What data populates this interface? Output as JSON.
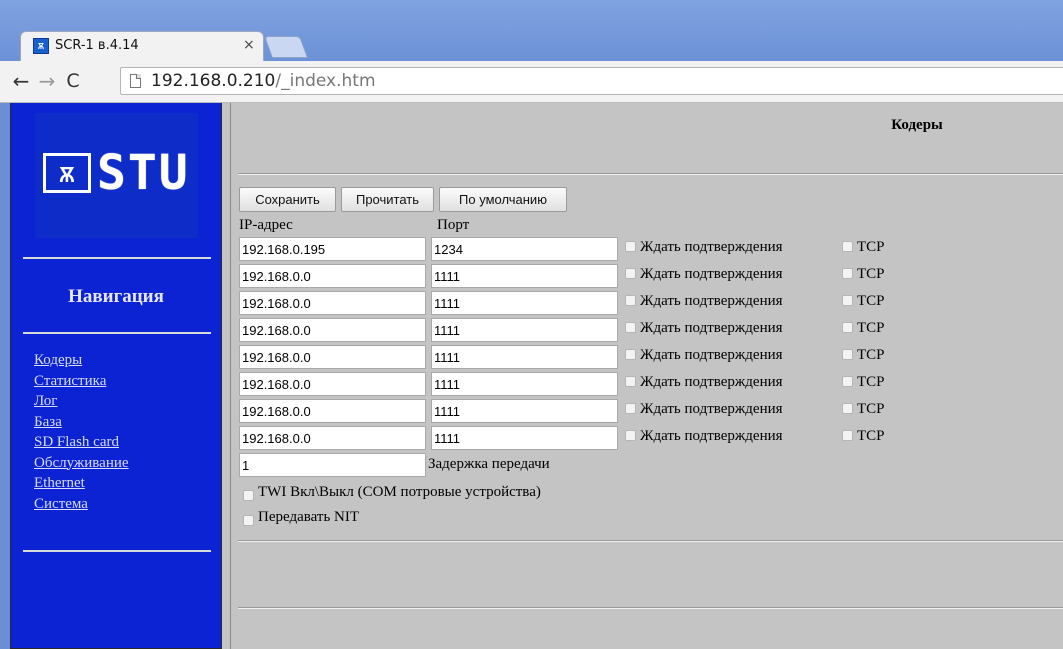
{
  "browser": {
    "tab_title": "SCR-1 в.4.14",
    "tab_close": "×",
    "favicon_glyph": "ѫ",
    "url_host": "192.168.0.210",
    "url_path": "/_index.htm",
    "back": "←",
    "forward": "→",
    "reload": "C"
  },
  "sidebar": {
    "logo_text": "STU",
    "logo_mark": "ѫ",
    "nav_title": "Навигация",
    "links": [
      "Кодеры",
      "Статистика",
      "Лог",
      "База",
      "SD Flash card",
      "Обслуживание",
      "Ethernet",
      "Система"
    ]
  },
  "content": {
    "title": "Кодеры",
    "buttons": {
      "save": "Сохранить",
      "read": "Прочитать",
      "defaults": "По умолчанию"
    },
    "header_ip": "IP-адрес",
    "header_port": "Порт",
    "wait_label": "Ждать подтверждения",
    "tcp_label": "TCP",
    "rows": [
      {
        "ip": "192.168.0.195",
        "port": "1234"
      },
      {
        "ip": "192.168.0.0",
        "port": "1111"
      },
      {
        "ip": "192.168.0.0",
        "port": "1111"
      },
      {
        "ip": "192.168.0.0",
        "port": "1111"
      },
      {
        "ip": "192.168.0.0",
        "port": "1111"
      },
      {
        "ip": "192.168.0.0",
        "port": "1111"
      },
      {
        "ip": "192.168.0.0",
        "port": "1111"
      },
      {
        "ip": "192.168.0.0",
        "port": "1111"
      }
    ],
    "delay_value": "1",
    "delay_label": "Задержка передачи",
    "twi_label": "TWI Вкл\\Выкл (COM потровые устройства)",
    "nit_label": "Передавать NIT"
  },
  "colors": {
    "sidebar_bg": "#0c23d4",
    "content_bg": "#c4c4c4",
    "chrome_bg": "#6a8fd2"
  }
}
